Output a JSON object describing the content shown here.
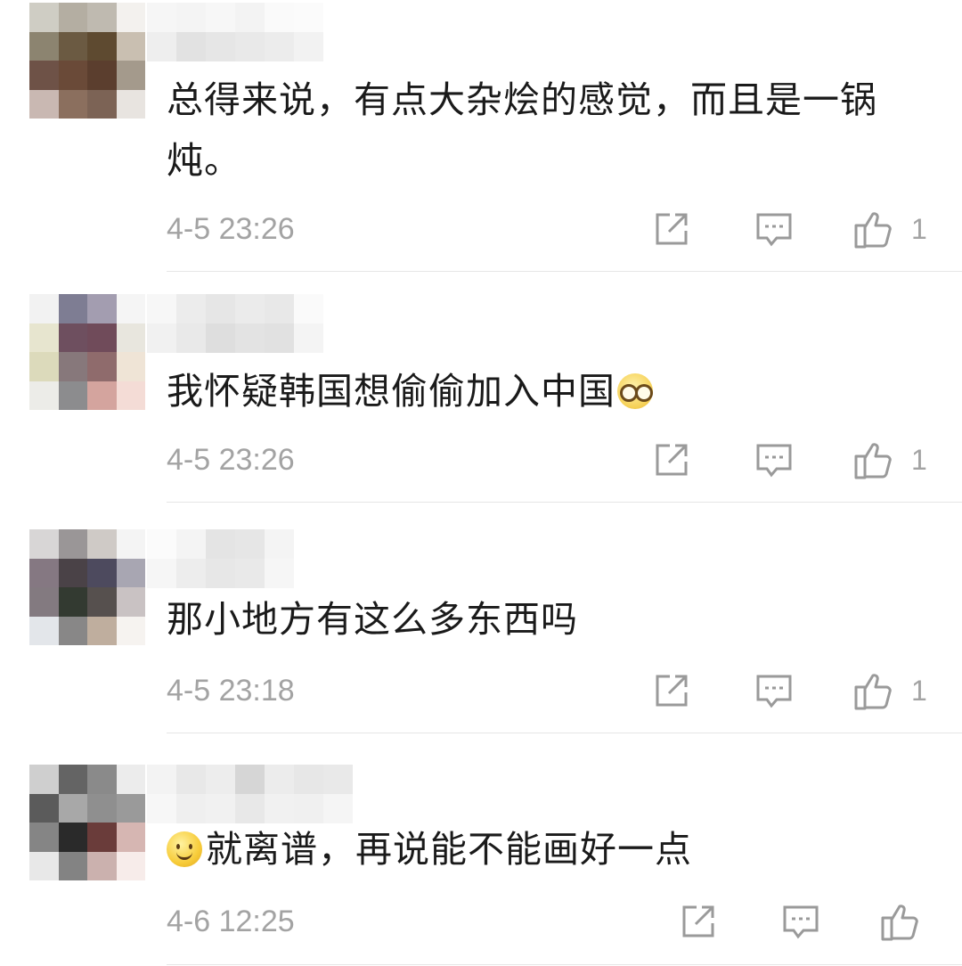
{
  "comments": [
    {
      "text": "总得来说，有点大杂烩的感觉，而且是一锅炖。",
      "time": "4-5 23:26",
      "likes": "1"
    },
    {
      "text": "我怀疑韩国想偷偷加入中国",
      "time": "4-5 23:26",
      "likes": "1"
    },
    {
      "text": "那小地方有这么多东西吗",
      "time": "4-5 23:18",
      "likes": "1"
    },
    {
      "text": "就离谱，再说能不能画好一点",
      "time": "4-6 12:25",
      "likes": ""
    }
  ],
  "icons": {
    "share": "share-icon",
    "reply": "reply-icon",
    "like": "like-icon",
    "emoji_glasses": "nerd-glasses-emoji",
    "emoji_smile": "smile-emoji"
  },
  "colors": {
    "meta_text": "#a3a3a3",
    "icon_stroke": "#9a9a9a",
    "divider": "#e6e6e6"
  }
}
